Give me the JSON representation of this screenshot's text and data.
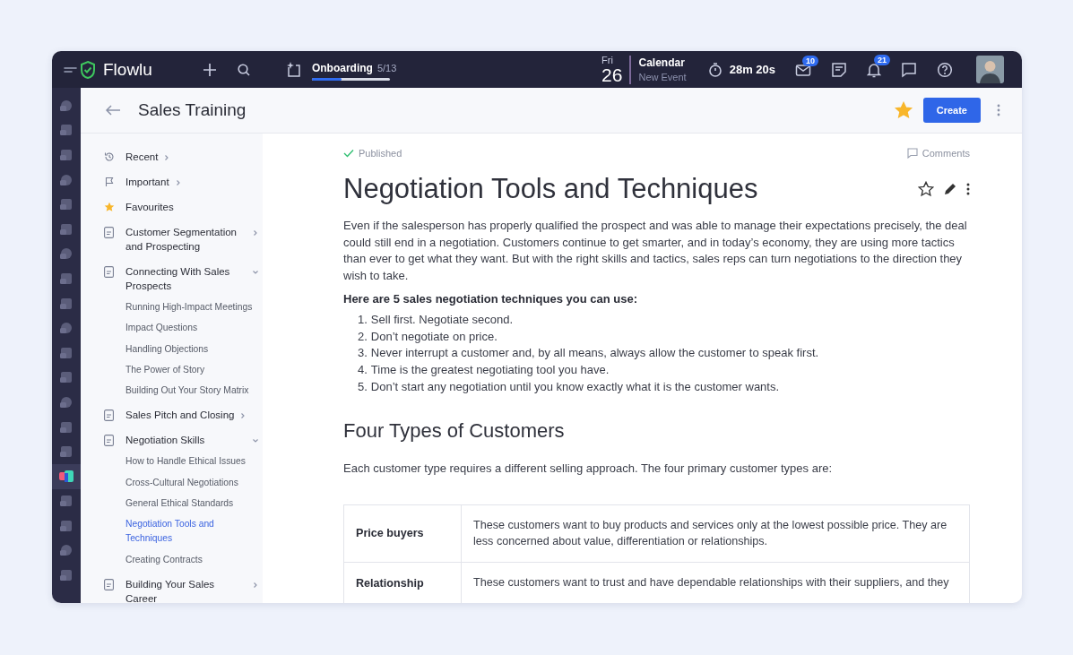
{
  "topbar": {
    "brand": "Flowlu",
    "onboarding": {
      "label": "Onboarding",
      "count": "5/13",
      "level": 0.38
    },
    "date": {
      "weekday": "Fri",
      "day": "26"
    },
    "calendar": {
      "title": "Calendar",
      "subtitle": "New Event"
    },
    "timer": "28m 20s",
    "mail_badge": "10",
    "notifications_badge": "21"
  },
  "rail": [
    {
      "selected": false
    },
    {
      "selected": false
    },
    {
      "selected": false
    },
    {
      "selected": false
    },
    {
      "selected": false
    },
    {
      "selected": false
    },
    {
      "selected": false
    },
    {
      "selected": false
    },
    {
      "selected": false
    },
    {
      "selected": false
    },
    {
      "selected": false
    },
    {
      "selected": false
    },
    {
      "selected": false
    },
    {
      "selected": false
    },
    {
      "selected": false
    },
    {
      "selected": true
    },
    {
      "selected": false
    },
    {
      "selected": false
    },
    {
      "selected": false
    },
    {
      "selected": false
    }
  ],
  "header": {
    "title": "Sales Training",
    "favourite": true,
    "create_button": "Create"
  },
  "sidebar": {
    "items": [
      {
        "kind": "history",
        "label": "Recent",
        "expanded": false
      },
      {
        "kind": "flag",
        "label": "Important",
        "expanded": false
      },
      {
        "kind": "star",
        "label": "Favourites"
      },
      {
        "kind": "page",
        "label": "Customer Segmentation and Prospecting",
        "expanded": false
      },
      {
        "kind": "page",
        "label": "Connecting With Sales Prospects",
        "expanded": true,
        "children": [
          {
            "label": "Running High-Impact Meetings",
            "selected": false
          },
          {
            "label": "Impact Questions",
            "selected": false
          },
          {
            "label": "Handling Objections",
            "selected": false
          },
          {
            "label": "The Power of Story",
            "selected": false
          },
          {
            "label": "Building Out Your Story Matrix",
            "selected": false
          }
        ]
      },
      {
        "kind": "page",
        "label": "Sales Pitch and Closing",
        "expanded": false
      },
      {
        "kind": "page",
        "label": "Negotiation Skills",
        "expanded": true,
        "children": [
          {
            "label": "How to Handle Ethical Issues",
            "selected": false
          },
          {
            "label": "Cross-Cultural Negotiations",
            "selected": false
          },
          {
            "label": "General Ethical Standards",
            "selected": false
          },
          {
            "label": "Negotiation Tools and Techniques",
            "selected": true
          },
          {
            "label": "Creating Contracts",
            "selected": false
          }
        ]
      },
      {
        "kind": "page",
        "label": "Building Your Sales Career",
        "expanded": false
      }
    ]
  },
  "article": {
    "status": "Published",
    "comments": "Comments",
    "title": "Negotiation Tools and Techniques",
    "starred": false,
    "intro": "Even if the salesperson has properly qualified the prospect and was able to manage their expectations precisely, the deal could still end in a negotiation. Customers continue to get smarter, and in today’s economy, they are using more tactics than ever to get what they want. But with the right skills and tactics, sales reps can turn negotiations to the direction they wish to take.",
    "list_heading": "Here are 5 sales negotiation techniques you can use:",
    "techniques": [
      {
        "number": "1.",
        "text": "Sell first. Negotiate second."
      },
      {
        "number": "2.",
        "text": "Don’t negotiate on price."
      },
      {
        "number": "3.",
        "text": "Never interrupt a customer and, by all means, always allow the customer to speak first."
      },
      {
        "number": "4.",
        "text": "Time is the greatest negotiating tool you have."
      },
      {
        "number": "5.",
        "text": "Don’t start any negotiation until you know exactly what it is the customer wants."
      }
    ],
    "section_heading": "Four Types of Customers",
    "section_text": "Each customer type requires a different selling approach. The four primary customer types are:",
    "table": {
      "rows": [
        {
          "type": "Price buyers",
          "description": "These customers want to buy products and services only at the lowest possible price. They are less concerned about value, differentiation or relationships."
        },
        {
          "type": "Relationship",
          "description": "These customers want to trust and have dependable relationships with their suppliers, and they"
        }
      ]
    }
  }
}
